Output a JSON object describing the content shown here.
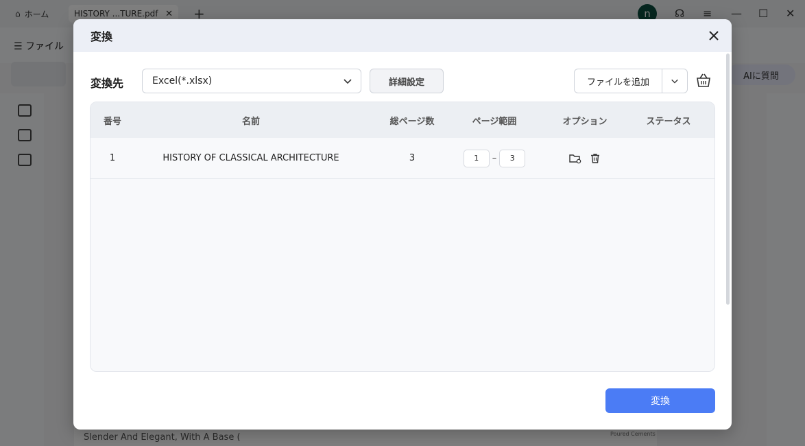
{
  "app": {
    "home_tab": "ホーム",
    "file_tab": "HISTORY ...TURE.pdf",
    "avatar_letter": "n",
    "menu_file": "ファイル",
    "ai_button": "AIに質問",
    "doc_text": "Slender And Elegant, With A Base (",
    "doc_text2": "Poured Cements"
  },
  "dialog": {
    "title": "変換",
    "convert_to_label": "変換先",
    "format_value": "Excel(*.xlsx)",
    "advanced_settings": "詳細設定",
    "add_file": "ファイルを追加",
    "convert_button": "変換"
  },
  "table": {
    "headers": {
      "no": "番号",
      "name": "名前",
      "pages": "総ページ数",
      "range": "ページ範囲",
      "options": "オプション",
      "status": "ステータス"
    },
    "rows": [
      {
        "no": "1",
        "name": "HISTORY OF CLASSICAL ARCHITECTURE",
        "pages": "3",
        "range_from": "1",
        "range_to": "3",
        "status": ""
      }
    ]
  },
  "colors": {
    "primary": "#4b7cf5",
    "avatar": "#0d4d3e"
  }
}
